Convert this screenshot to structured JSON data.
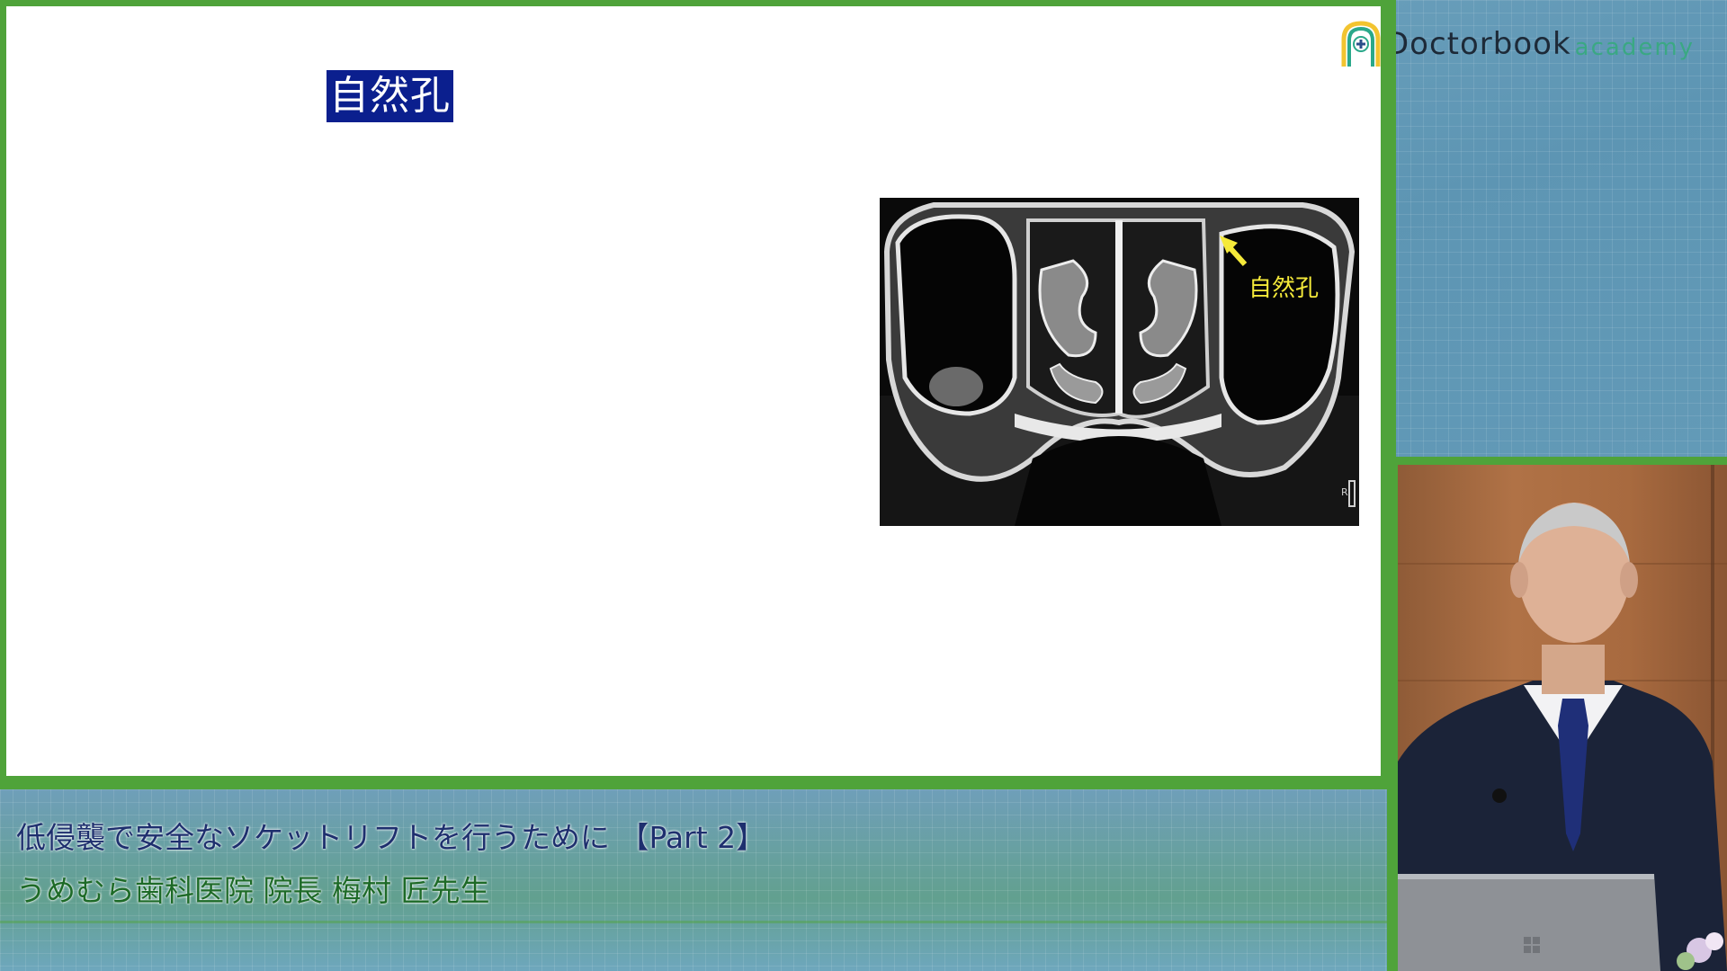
{
  "slide": {
    "title": "自然孔",
    "image_annotation": "自然孔",
    "image_marker": "R"
  },
  "logo": {
    "brand": "Doctorbook",
    "sub": "academy"
  },
  "caption": {
    "title": "低侵襲で安全なソケットリフトを行うために 【Part 2】",
    "presenter": "うめむら歯科医院 院長 梅村 匠先生"
  },
  "colors": {
    "frame_green": "#4fa33a",
    "title_bg": "#0b1f8e",
    "annotation_yellow": "#f5ea3a",
    "caption_title": "#1e2f6e",
    "caption_presenter": "#1d6a27"
  }
}
